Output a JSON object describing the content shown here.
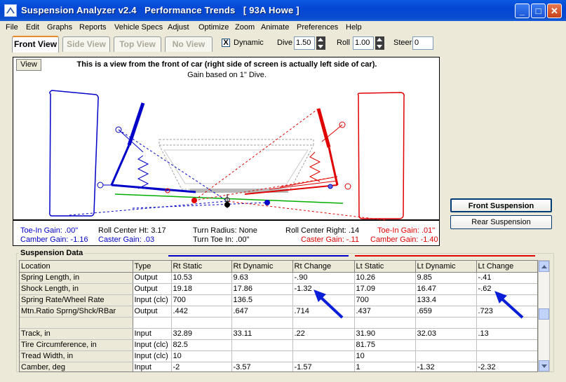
{
  "window": {
    "title": "Suspension Analyzer v2.4   Performance Trends   [ 93A Howe ]",
    "controls": {
      "minimize": "_",
      "maximize": "□",
      "close": "✕"
    }
  },
  "menu": [
    "File",
    "Edit",
    "Graphs",
    "Reports",
    "Vehicle Specs",
    "Adjust",
    "Optimize",
    "Zoom",
    "Animate",
    "Preferences",
    "Help"
  ],
  "toolbar": {
    "tabs": [
      "Front View",
      "Side View",
      "Top View",
      "No View"
    ],
    "dynamic_label": "Dynamic",
    "dynamic_checked": "X",
    "dive_label": "Dive",
    "dive_value": "1.50",
    "roll_label": "Roll",
    "roll_value": "1.00",
    "steer_label": "Steer",
    "steer_value": "0"
  },
  "view": {
    "button": "View",
    "title": "This is a view from the front of car (right side of screen is actually left side of car).",
    "subtitle": "Gain based on 1\" Dive.",
    "readouts": {
      "rt_toe_gain": "Toe-In Gain: .00\"",
      "rt_camber_gain": "Camber Gain: -1.16",
      "roll_center_ht": "Roll Center Ht: 3.17",
      "rt_caster_gain": "Caster Gain: .03",
      "turn_radius": "Turn Radius: None",
      "turn_toe_in": "Turn Toe In: .00\"",
      "roll_center_right": "Roll Center Right: .14",
      "lt_caster_gain": "Caster Gain: -.11",
      "lt_toe_gain": "Toe-In Gain: .01\"",
      "lt_camber_gain": "Camber Gain: -1.40"
    }
  },
  "side_buttons": {
    "front": "Front Suspension",
    "rear": "Rear Suspension"
  },
  "colors": {
    "right_side": "#0000c8",
    "left_side": "#e00000",
    "arrow": "#0a1ed8"
  },
  "table": {
    "group_label": "Suspension Data",
    "headers": [
      "Location",
      "Type",
      "Rt Static",
      "Rt Dynamic",
      "Rt Change",
      "Lt Static",
      "Lt Dynamic",
      "Lt Change"
    ],
    "rows": [
      [
        "Spring Length, in",
        "Output",
        "10.53",
        "9.63",
        "-.90",
        "10.26",
        "9.85",
        "-.41"
      ],
      [
        "Shock Length, in",
        "Output",
        "19.18",
        "17.86",
        "-1.32",
        "17.09",
        "16.47",
        "-.62"
      ],
      [
        "Spring Rate/Wheel Rate",
        "Input (clc)",
        "700",
        "136.5",
        "",
        "700",
        "133.4",
        ""
      ],
      [
        "Mtn.Ratio Sprng/Shck/RBar",
        "Output",
        ".442",
        ".647",
        ".714",
        ".437",
        ".659",
        ".723"
      ],
      [
        "",
        "",
        "",
        "",
        "",
        "",
        "",
        ""
      ],
      [
        "Track, in",
        "Input",
        "32.89",
        "33.11",
        ".22",
        "31.90",
        "32.03",
        ".13"
      ],
      [
        "Tire Circumference, in",
        "Input (clc)",
        "82.5",
        "",
        "",
        "81.75",
        "",
        ""
      ],
      [
        "Tread Width, in",
        "Input (clc)",
        "10",
        "",
        "",
        "10",
        "",
        ""
      ],
      [
        "Camber, deg",
        "Input",
        "-2",
        "-3.57",
        "-1.57",
        "1",
        "-1.32",
        "-2.32"
      ]
    ]
  }
}
